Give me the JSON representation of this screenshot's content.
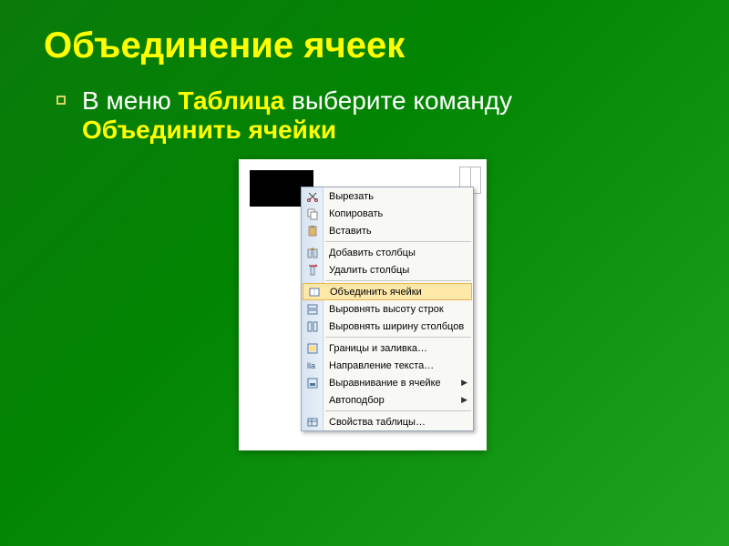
{
  "title": "Объединение ячеек",
  "body": {
    "prefix": "В меню ",
    "menu_name": "Таблица",
    "middle": " выберите команду ",
    "command": "Объединить ячейки"
  },
  "context_menu": {
    "items": [
      {
        "label": "Вырезать",
        "icon": "cut-icon",
        "submenu": false
      },
      {
        "label": "Копировать",
        "icon": "copy-icon",
        "submenu": false
      },
      {
        "label": "Вставить",
        "icon": "paste-icon",
        "submenu": false
      }
    ],
    "items2": [
      {
        "label": "Добавить столбцы",
        "icon": "insert-cols-icon",
        "submenu": false
      },
      {
        "label": "Удалить столбцы",
        "icon": "delete-cols-icon",
        "submenu": false
      }
    ],
    "items3": [
      {
        "label": "Объединить ячейки",
        "icon": "merge-cells-icon",
        "submenu": false,
        "highlighted": true
      },
      {
        "label": "Выровнять высоту строк",
        "icon": "row-height-icon",
        "submenu": false
      },
      {
        "label": "Выровнять ширину столбцов",
        "icon": "col-width-icon",
        "submenu": false
      }
    ],
    "items4": [
      {
        "label": "Границы и заливка…",
        "icon": "borders-icon",
        "submenu": false
      },
      {
        "label": "Направление текста…",
        "icon": "text-dir-icon",
        "submenu": false
      },
      {
        "label": "Выравнивание в ячейке",
        "icon": "align-cell-icon",
        "submenu": true
      },
      {
        "label": "Автоподбор",
        "icon": "",
        "submenu": true
      }
    ],
    "items5": [
      {
        "label": "Свойства таблицы…",
        "icon": "table-props-icon",
        "submenu": false
      }
    ]
  }
}
